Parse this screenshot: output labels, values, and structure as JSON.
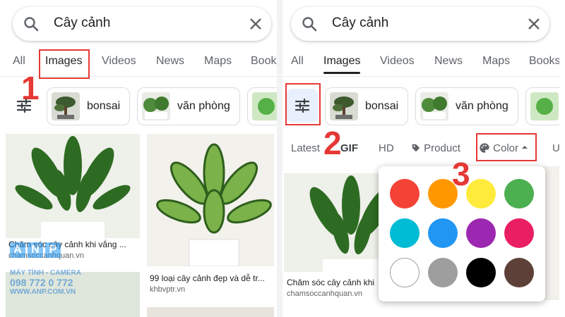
{
  "search": {
    "query": "Cây cảnh"
  },
  "tabs": [
    "All",
    "Images",
    "Videos",
    "News",
    "Maps",
    "Books"
  ],
  "chips": [
    {
      "label": "bonsai"
    },
    {
      "label": "văn phòng"
    }
  ],
  "results": [
    {
      "caption": "Chăm sóc cây cảnh khi vắng ...",
      "source": "chamsoccanhquan.vn"
    },
    {
      "caption": "99 loại cây cảnh đẹp và dễ tr...",
      "source": "khbvptr.vn"
    }
  ],
  "right_results": [
    {
      "caption": "Chăm sóc cây cảnh khi ...",
      "source": "chamsoccanhquan.vn"
    }
  ],
  "filters": [
    "Latest",
    "GIF",
    "HD",
    "Product",
    "Color",
    "Us"
  ],
  "colors": [
    "#f44336",
    "#ff9800",
    "#ffeb3b",
    "#4caf50",
    "#00bcd4",
    "#2196f3",
    "#9c27b0",
    "#e91e63",
    "#ffffff",
    "#9e9e9e",
    "#000000",
    "#5d4037"
  ],
  "annotations": {
    "step1": "1",
    "step2": "2",
    "step3": "3"
  },
  "watermark": {
    "letters": [
      "A",
      "N",
      "P"
    ],
    "line1": "MÁY TÍNH - CAMERA",
    "line2": "098 772 0 772",
    "line3": "WWW.ANP.COM.VN"
  },
  "accent": "#e53935"
}
